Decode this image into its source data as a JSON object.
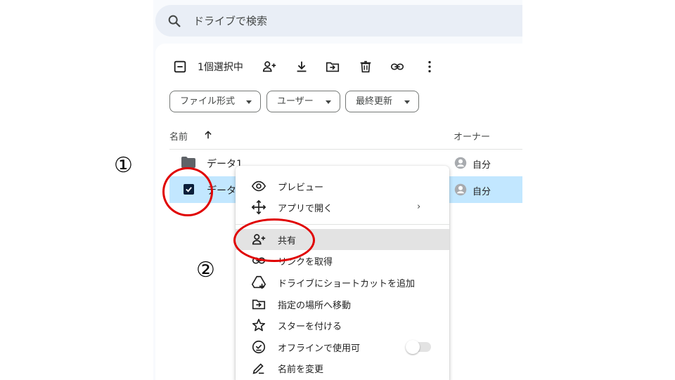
{
  "search": {
    "placeholder": "ドライブで検索",
    "icon": "search-icon"
  },
  "selection_toolbar": {
    "count_label": "1個選択中",
    "icons": [
      "deselect-icon",
      "share-icon",
      "download-icon",
      "move-icon",
      "trash-icon",
      "link-icon",
      "more-vert-icon"
    ]
  },
  "filters": [
    {
      "label": "ファイル形式"
    },
    {
      "label": "ユーザー"
    },
    {
      "label": "最終更新"
    }
  ],
  "columns": {
    "name": "名前",
    "owner": "オーナー"
  },
  "files": [
    {
      "name": "データ1",
      "owner": "自分",
      "selected": false,
      "icon": "folder-icon"
    },
    {
      "name": "データ",
      "owner": "自分",
      "selected": true,
      "icon": "checkbox-checked-icon"
    }
  ],
  "context_menu": {
    "groups": [
      [
        {
          "label": "プレビュー",
          "icon": "eye-icon"
        },
        {
          "label": "アプリで開く",
          "icon": "open-with-icon",
          "submenu": true
        }
      ],
      [
        {
          "label": "共有",
          "icon": "share-icon",
          "highlighted": true
        },
        {
          "label": "リンクを取得",
          "icon": "link-icon"
        },
        {
          "label": "ドライブにショートカットを追加",
          "icon": "add-shortcut-icon"
        },
        {
          "label": "指定の場所へ移動",
          "icon": "move-icon"
        },
        {
          "label": "スターを付ける",
          "icon": "star-icon"
        },
        {
          "label": "オフラインで使用可",
          "icon": "offline-icon",
          "toggle": false
        },
        {
          "label": "名前を変更",
          "icon": "rename-icon"
        }
      ]
    ]
  },
  "annotations": {
    "step1": "①",
    "step2": "②",
    "ring_color": "#e00000"
  },
  "colors": {
    "selected_row": "#c2e7ff",
    "search_bg": "#e9eef6",
    "menu_highlight": "#e3e3e3"
  }
}
